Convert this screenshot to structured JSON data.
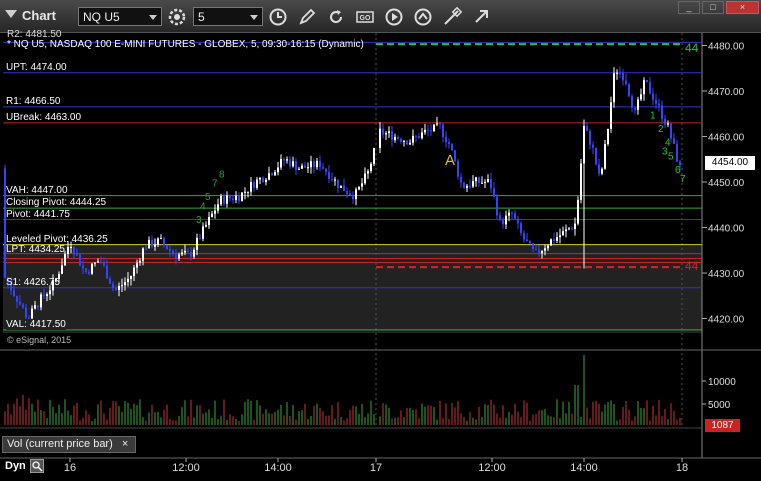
{
  "window": {
    "title": "Chart",
    "min": "_",
    "max": "□",
    "close": "×"
  },
  "toolbar": {
    "symbol": "NQ U5",
    "interval": "5",
    "icons": [
      "settings-icon",
      "clock-icon",
      "pencil-icon",
      "refresh-icon",
      "study-icon",
      "play-icon",
      "draw-tool-icon",
      "link-icon"
    ]
  },
  "chart": {
    "header": "* NQ U5, NASDAQ 100 E-MINI FUTURES - GLOBEX, 5, 09:30-16:15 (Dynamic)",
    "r2_partial": "R2: 4481.50",
    "watermark": "© eSignal, 2015",
    "last_price": "4454.00",
    "marker_a": "A",
    "green_line_label": "44",
    "red_line_label": "44",
    "levels": [
      {
        "label": "UPT: 4474.00",
        "price": 4474.0,
        "color": "#3333cc"
      },
      {
        "label": "R1: 4466.50",
        "price": 4466.5,
        "color": "#3333cc"
      },
      {
        "label": "UBreak: 4463.00",
        "price": 4463.0,
        "color": "#cc2222"
      },
      {
        "label": "VAH: 4447.00",
        "price": 4447.0,
        "color": "#33aa33"
      },
      {
        "label": "Closing Pivot: 4444.25",
        "price": 4444.25,
        "color": "#33aa33"
      },
      {
        "label": "Pivot: 4441.75",
        "price": 4441.75,
        "color": "#3333cc"
      },
      {
        "label": "Leveled Pivot: 4436.25",
        "price": 4436.25,
        "color": "#cccc33"
      },
      {
        "label": "LPT: 4434.25",
        "price": 4434.25,
        "color": "#cc2222"
      },
      {
        "label": "S1: 4426.75",
        "price": 4426.75,
        "color": "#3333cc"
      },
      {
        "label": "VAL: 4417.50",
        "price": 4417.5,
        "color": "#33aa33"
      }
    ],
    "price_axis": {
      "ticks": [
        "4480.00",
        "4470.00",
        "4460.00",
        "4450.00",
        "4440.00",
        "4430.00",
        "4420.00"
      ]
    },
    "volume_axis": {
      "ticks": [
        "10000",
        "5000"
      ],
      "last": "1087"
    },
    "time_axis": {
      "ticks": [
        "16",
        "12:00",
        "14:00",
        "17",
        "12:00",
        "14:00",
        "18"
      ]
    },
    "study_label": "Vol (current price bar)",
    "study_close": "×",
    "bottom_label": "Dyn"
  },
  "colors": {
    "up_bar": "#ffffff",
    "down_bar": "#3344ff",
    "volume_up": "#33aa33",
    "volume_down": "#cc3333",
    "accent_green": "#22cc22",
    "accent_red": "#dd2222"
  }
}
